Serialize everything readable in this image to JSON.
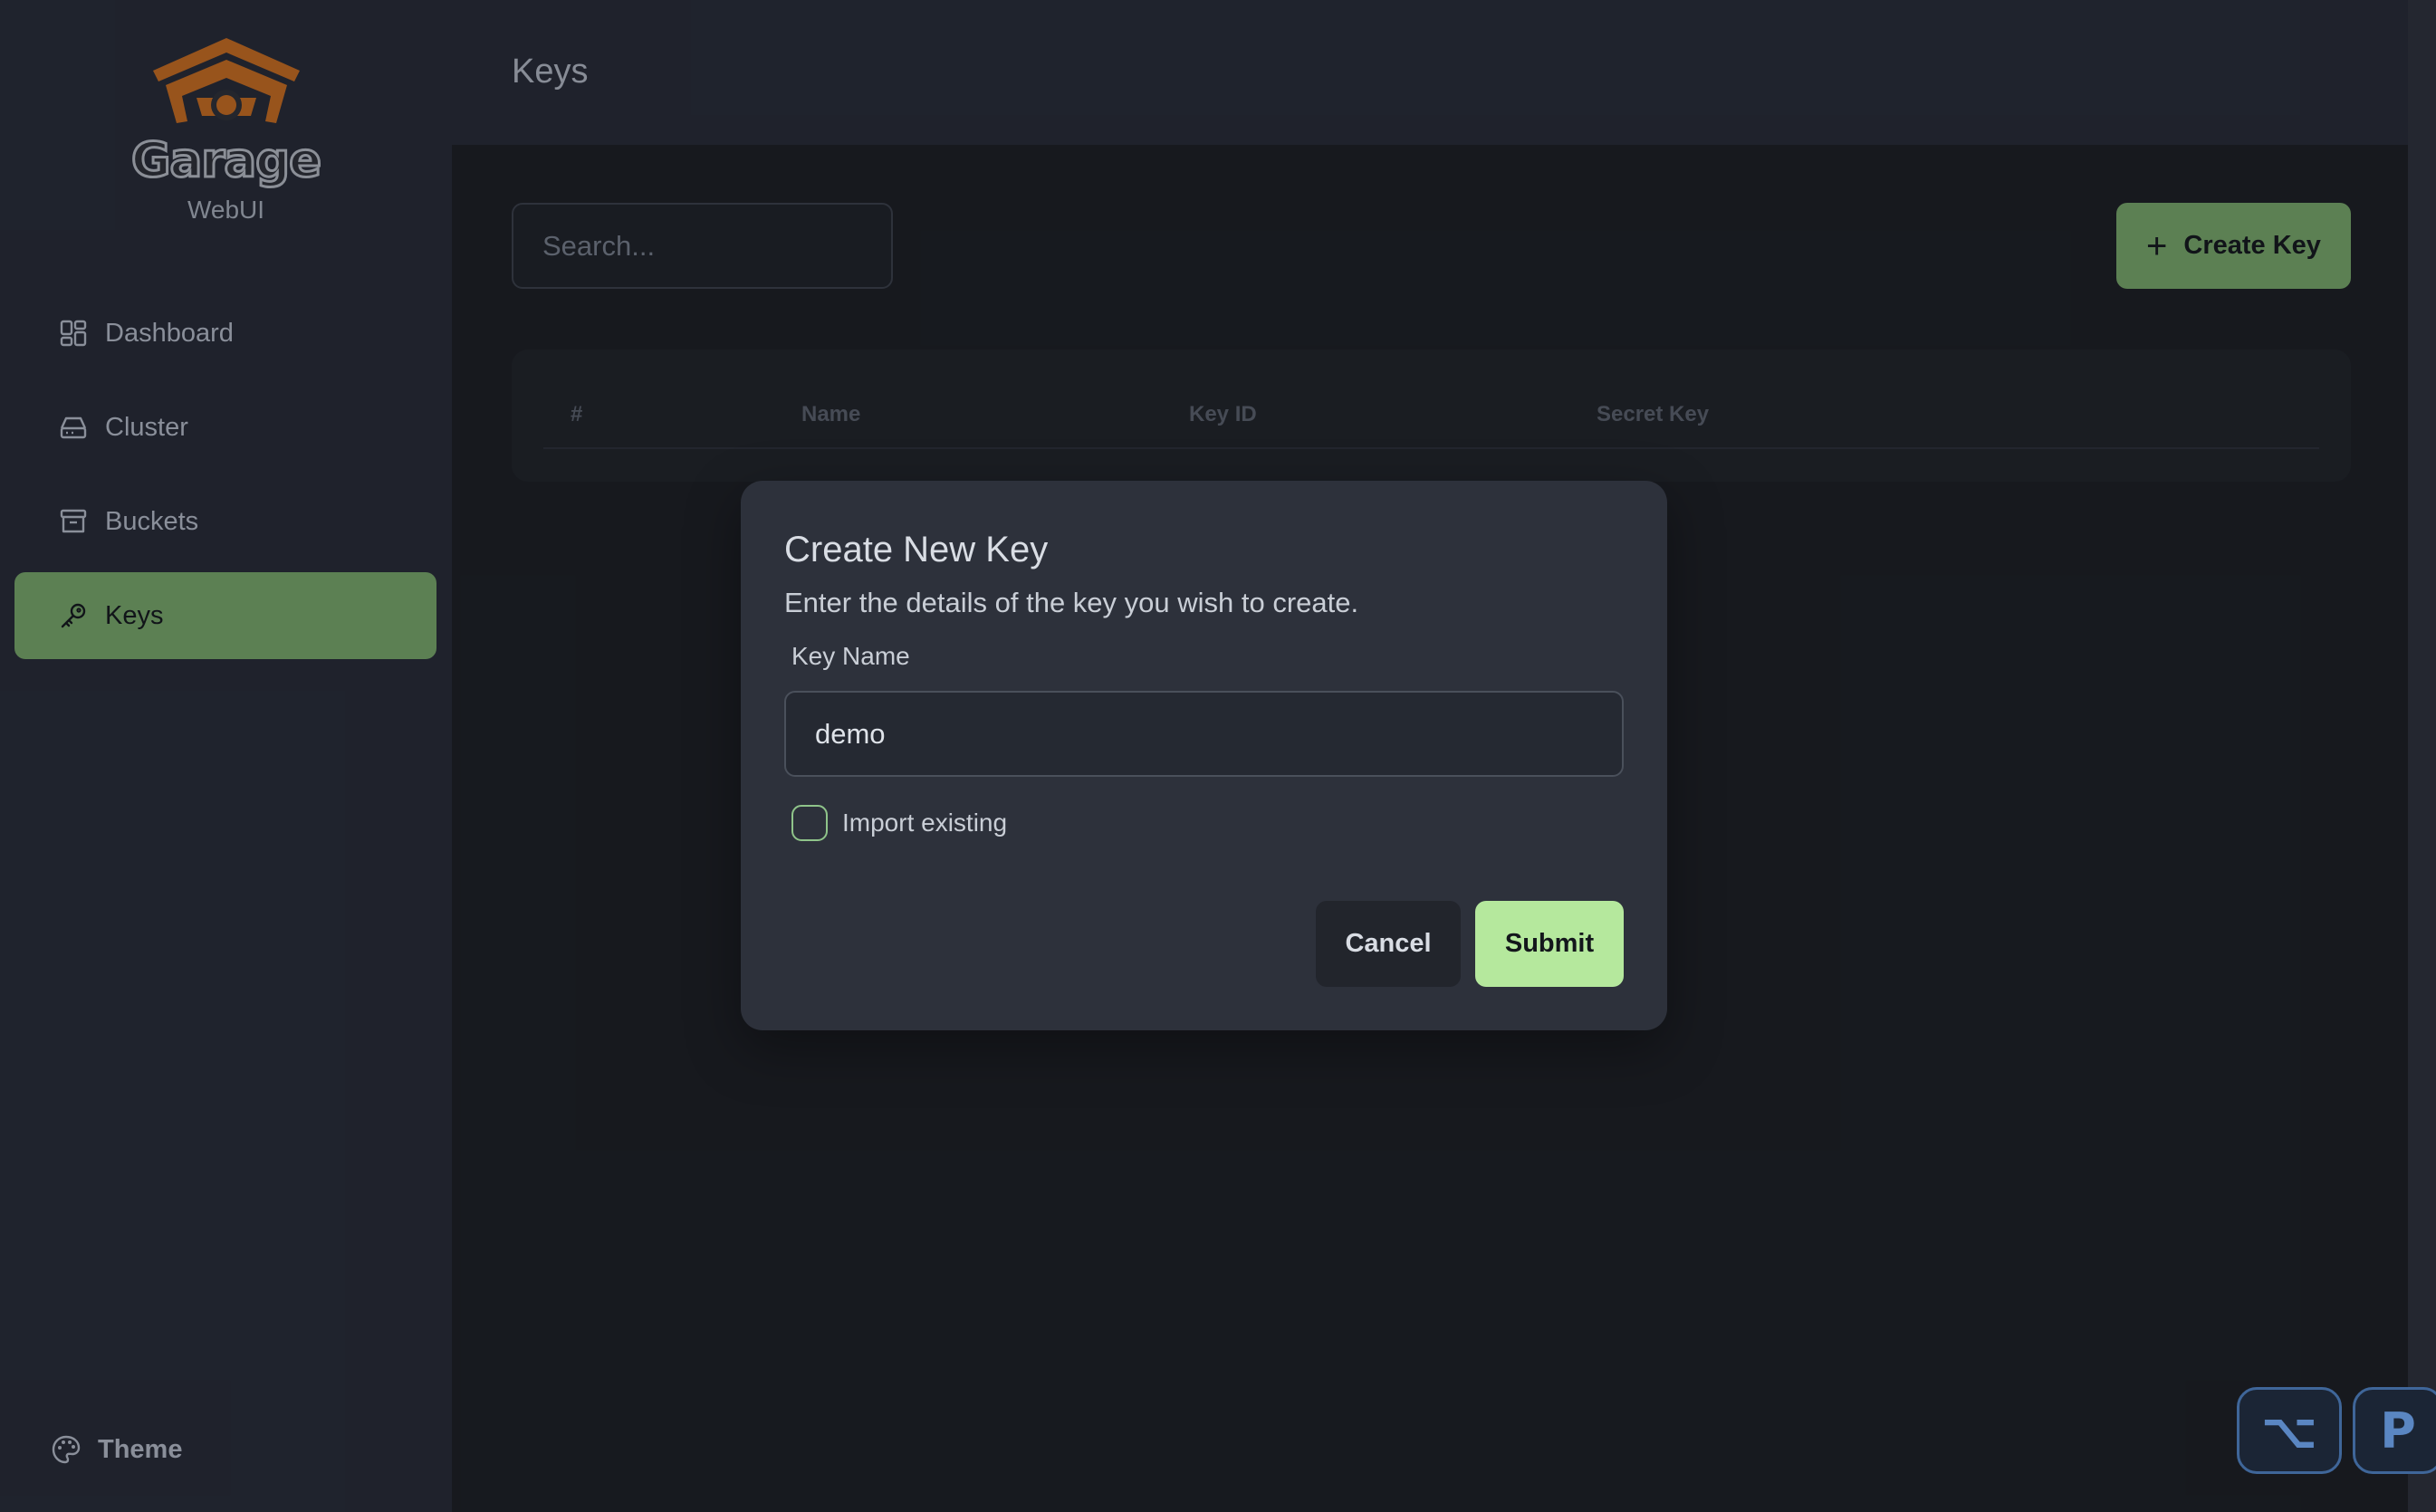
{
  "sidebar": {
    "brand": {
      "name": "Garage",
      "subtitle": "WebUI"
    },
    "items": [
      {
        "label": "Dashboard",
        "icon": "dashboard-icon",
        "active": false
      },
      {
        "label": "Cluster",
        "icon": "hard-drive-icon",
        "active": false
      },
      {
        "label": "Buckets",
        "icon": "archive-icon",
        "active": false
      },
      {
        "label": "Keys",
        "icon": "key-icon",
        "active": true
      }
    ],
    "theme_label": "Theme"
  },
  "header": {
    "title": "Keys"
  },
  "toolbar": {
    "search_placeholder": "Search...",
    "create_label": "Create Key"
  },
  "table": {
    "columns": [
      "#",
      "Name",
      "Key ID",
      "Secret Key"
    ],
    "rows": []
  },
  "modal": {
    "title": "Create New Key",
    "description": "Enter the details of the key you wish to create.",
    "field_label": "Key Name",
    "field_value": "demo",
    "checkbox_label": "Import existing",
    "checkbox_checked": false,
    "cancel_label": "Cancel",
    "submit_label": "Submit"
  },
  "key_hints": {
    "alt": "⌥",
    "p": "P"
  },
  "colors": {
    "accent": "#6e9a62",
    "submit": "#b5e89d",
    "logo": "#b8651f",
    "sidebar_bg": "#242833",
    "page_bg": "#1a1d22"
  }
}
